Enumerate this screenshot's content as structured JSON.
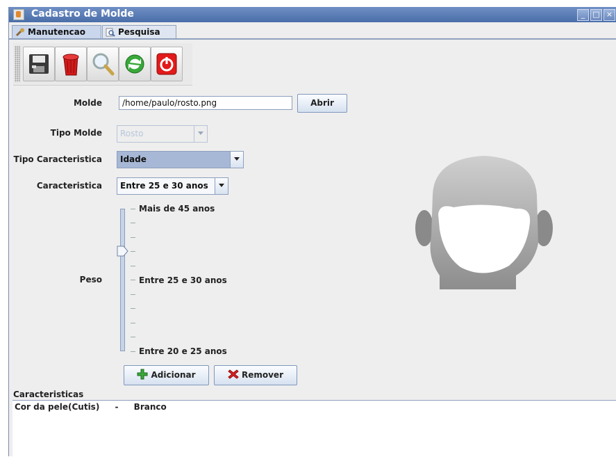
{
  "window": {
    "title": "Cadastro de Molde"
  },
  "tabs": [
    {
      "label": "Manutencao",
      "icon": "wrench-icon"
    },
    {
      "label": "Pesquisa",
      "icon": "magnifier-icon"
    }
  ],
  "toolbar": {
    "buttons": [
      "save-icon",
      "trash-icon",
      "search-icon",
      "refresh-icon",
      "exit-icon"
    ]
  },
  "form": {
    "molde_label": "Molde",
    "molde_value": "/home/paulo/rosto.png",
    "abrir_label": "Abrir",
    "tipo_molde_label": "Tipo Molde",
    "tipo_molde_value": "Rosto",
    "tipo_caracteristica_label": "Tipo Caracteristica",
    "tipo_caracteristica_value": "Idade",
    "caracteristica_label": "Caracteristica",
    "caracteristica_value": "Entre 25 e 30 anos",
    "peso_label": "Peso",
    "slider": {
      "labels": [
        "Mais de 45 anos",
        "Entre 25 e 30 anos",
        "Entre 20 e 25 anos"
      ],
      "level": 0.7
    },
    "adicionar_label": "Adicionar",
    "remover_label": "Remover"
  },
  "caracteristicas": {
    "header": "Caracteristicas",
    "rows": [
      {
        "name": "Cor da pele(Cutis)",
        "sep": "-",
        "value": "Branco"
      }
    ]
  },
  "colors": {
    "titlebar": "#5578b4",
    "selected_combo": "#a7b8d6"
  }
}
